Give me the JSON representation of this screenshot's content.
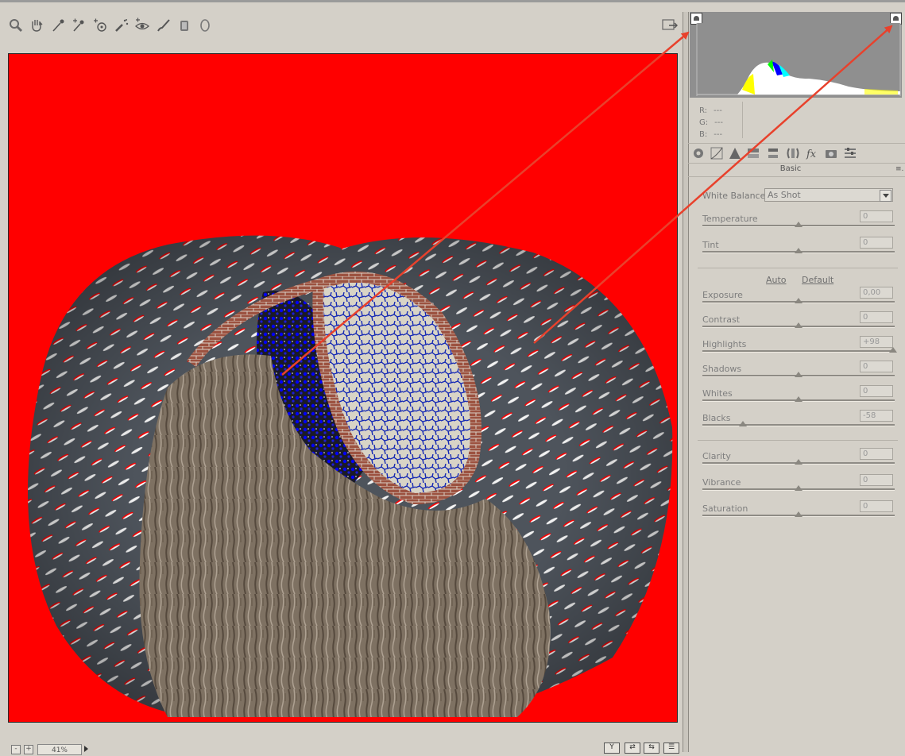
{
  "toolbar": {
    "tools": [
      {
        "name": "zoom-tool",
        "icon": "magnifier-icon"
      },
      {
        "name": "hand-tool",
        "icon": "hand-icon"
      },
      {
        "name": "white-balance-tool",
        "icon": "eyedropper-icon"
      },
      {
        "name": "color-sampler-tool",
        "icon": "eyedropper-plus-icon"
      },
      {
        "name": "targeted-adjustment-tool",
        "icon": "target-icon"
      },
      {
        "name": "spot-removal-tool",
        "icon": "brush-dots-icon"
      },
      {
        "name": "red-eye-tool",
        "icon": "eye-icon"
      },
      {
        "name": "adjustment-brush-tool",
        "icon": "brush-icon"
      },
      {
        "name": "graduated-filter-tool",
        "icon": "graduated-filter-icon"
      },
      {
        "name": "radial-filter-tool",
        "icon": "radial-filter-icon"
      }
    ]
  },
  "histogram": {
    "rgb": [
      {
        "label": "R:",
        "value": "---"
      },
      {
        "label": "G:",
        "value": "---"
      },
      {
        "label": "B:",
        "value": "---"
      }
    ]
  },
  "panel": {
    "title": "Basic",
    "menu_icon": "≡.",
    "white_balance": {
      "label": "White Balance:",
      "value": "As Shot"
    },
    "auto_label": "Auto",
    "default_label": "Default",
    "controls": [
      {
        "id": "temperature",
        "label": "Temperature",
        "value": "0",
        "level": 0.5
      },
      {
        "id": "tint",
        "label": "Tint",
        "value": "0",
        "level": 0.5
      },
      {
        "id": "exposure",
        "label": "Exposure",
        "value": "0,00",
        "level": 0.5
      },
      {
        "id": "contrast",
        "label": "Contrast",
        "value": "0",
        "level": 0.5
      },
      {
        "id": "highlights",
        "label": "Highlights",
        "value": "+98",
        "level": 0.99
      },
      {
        "id": "shadows",
        "label": "Shadows",
        "value": "0",
        "level": 0.5
      },
      {
        "id": "whites",
        "label": "Whites",
        "value": "0",
        "level": 0.5
      },
      {
        "id": "blacks",
        "label": "Blacks",
        "value": "-58",
        "level": 0.21
      },
      {
        "id": "clarity",
        "label": "Clarity",
        "value": "0",
        "level": 0.5
      },
      {
        "id": "vibrance",
        "label": "Vibrance",
        "value": "0",
        "level": 0.5
      },
      {
        "id": "saturation",
        "label": "Saturation",
        "value": "0",
        "level": 0.5
      }
    ]
  },
  "bottombar": {
    "zoom_minus": "-",
    "zoom_plus": "+",
    "zoom_value": "41%"
  },
  "colors": {
    "clipping_highlight": "#ff0000",
    "clipping_shadow": "#0000ff",
    "annotation_arrow": "#e8412c",
    "ui_background": "#d4d0c8"
  }
}
